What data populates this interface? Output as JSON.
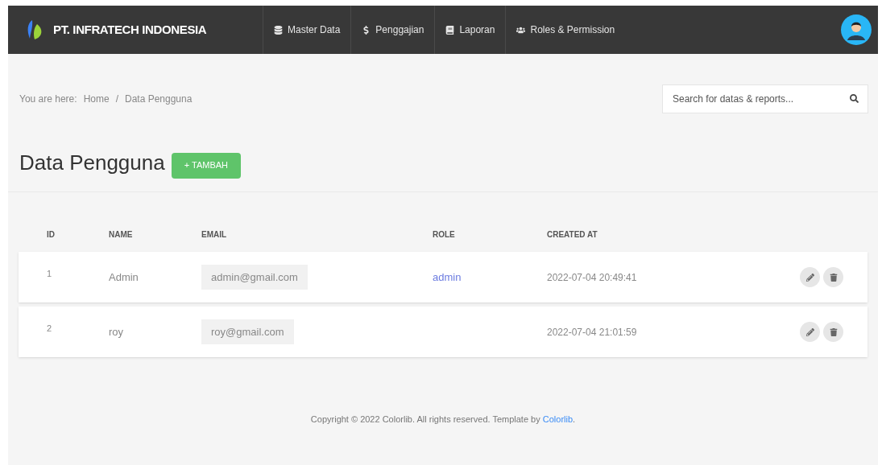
{
  "brand": {
    "name": "PT. INFRATECH INDONESIA"
  },
  "nav": [
    {
      "label": "Master Data"
    },
    {
      "label": "Penggajian"
    },
    {
      "label": "Laporan"
    },
    {
      "label": "Roles & Permission"
    }
  ],
  "breadcrumb": {
    "prefix": "You are here:",
    "items": [
      "Home",
      "Data Pengguna"
    ],
    "separator": "/"
  },
  "search": {
    "placeholder": "Search for datas & reports..."
  },
  "page": {
    "title": "Data Pengguna",
    "add_button": "+ TAMBAH"
  },
  "table": {
    "columns": [
      "ID",
      "NAME",
      "EMAIL",
      "ROLE",
      "CREATED AT"
    ],
    "rows": [
      {
        "id": "1",
        "name": "Admin",
        "email": "admin@gmail.com",
        "role": "admin",
        "created_at": "2022-07-04 20:49:41"
      },
      {
        "id": "2",
        "name": "roy",
        "email": "roy@gmail.com",
        "created_at": "2022-07-04 21:01:59"
      }
    ]
  },
  "footer": {
    "text": "Copyright © 2022 Colorlib. All rights reserved. Template by ",
    "link": "Colorlib",
    "suffix": "."
  }
}
